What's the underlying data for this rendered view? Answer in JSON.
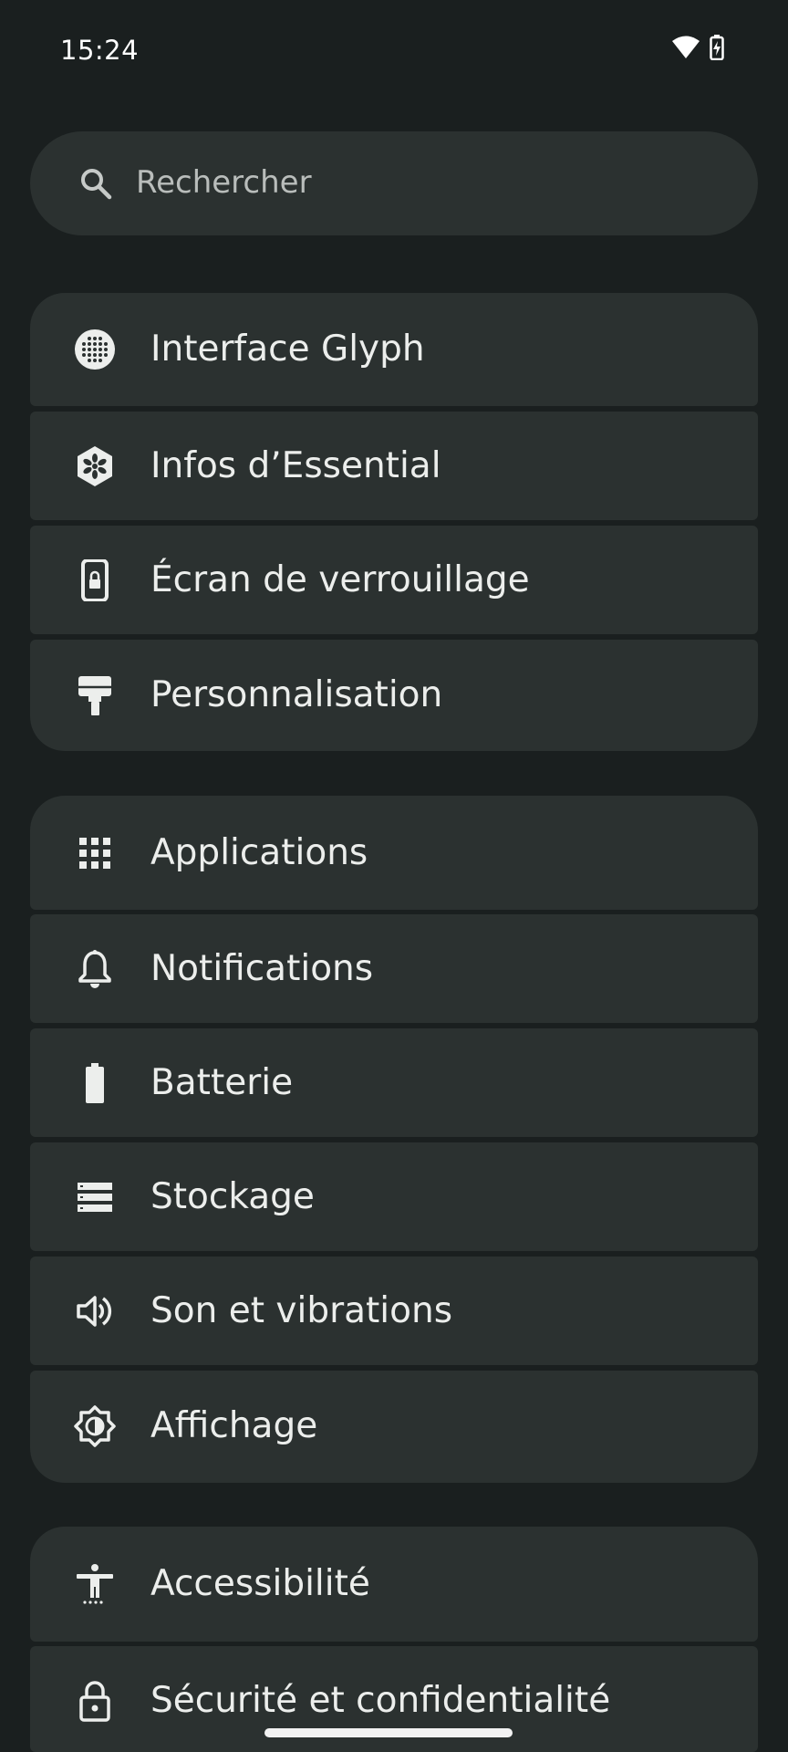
{
  "status_bar": {
    "time": "15:24",
    "icons": [
      "wifi-icon",
      "battery-charging-icon"
    ]
  },
  "search": {
    "placeholder": "Rechercher",
    "icon": "search-icon"
  },
  "groups": [
    {
      "items": [
        {
          "label": "Interface Glyph",
          "icon": "glyph-icon"
        },
        {
          "label": "Infos d’Essential",
          "icon": "essential-icon"
        },
        {
          "label": "Écran de verrouillage",
          "icon": "lock-screen-icon"
        },
        {
          "label": "Personnalisation",
          "icon": "paint-roller-icon"
        }
      ]
    },
    {
      "items": [
        {
          "label": "Applications",
          "icon": "apps-grid-icon"
        },
        {
          "label": "Notifications",
          "icon": "bell-icon"
        },
        {
          "label": "Batterie",
          "icon": "battery-icon"
        },
        {
          "label": "Stockage",
          "icon": "storage-icon"
        },
        {
          "label": "Son et vibrations",
          "icon": "volume-icon"
        },
        {
          "label": "Affichage",
          "icon": "brightness-icon"
        }
      ]
    },
    {
      "items": [
        {
          "label": "Accessibilité",
          "icon": "accessibility-icon"
        },
        {
          "label": "Sécurité et confidentialité",
          "icon": "padlock-icon"
        }
      ]
    }
  ],
  "colors": {
    "background": "#1a1f1f",
    "card": "#2b3130",
    "text": "#eceeec"
  }
}
